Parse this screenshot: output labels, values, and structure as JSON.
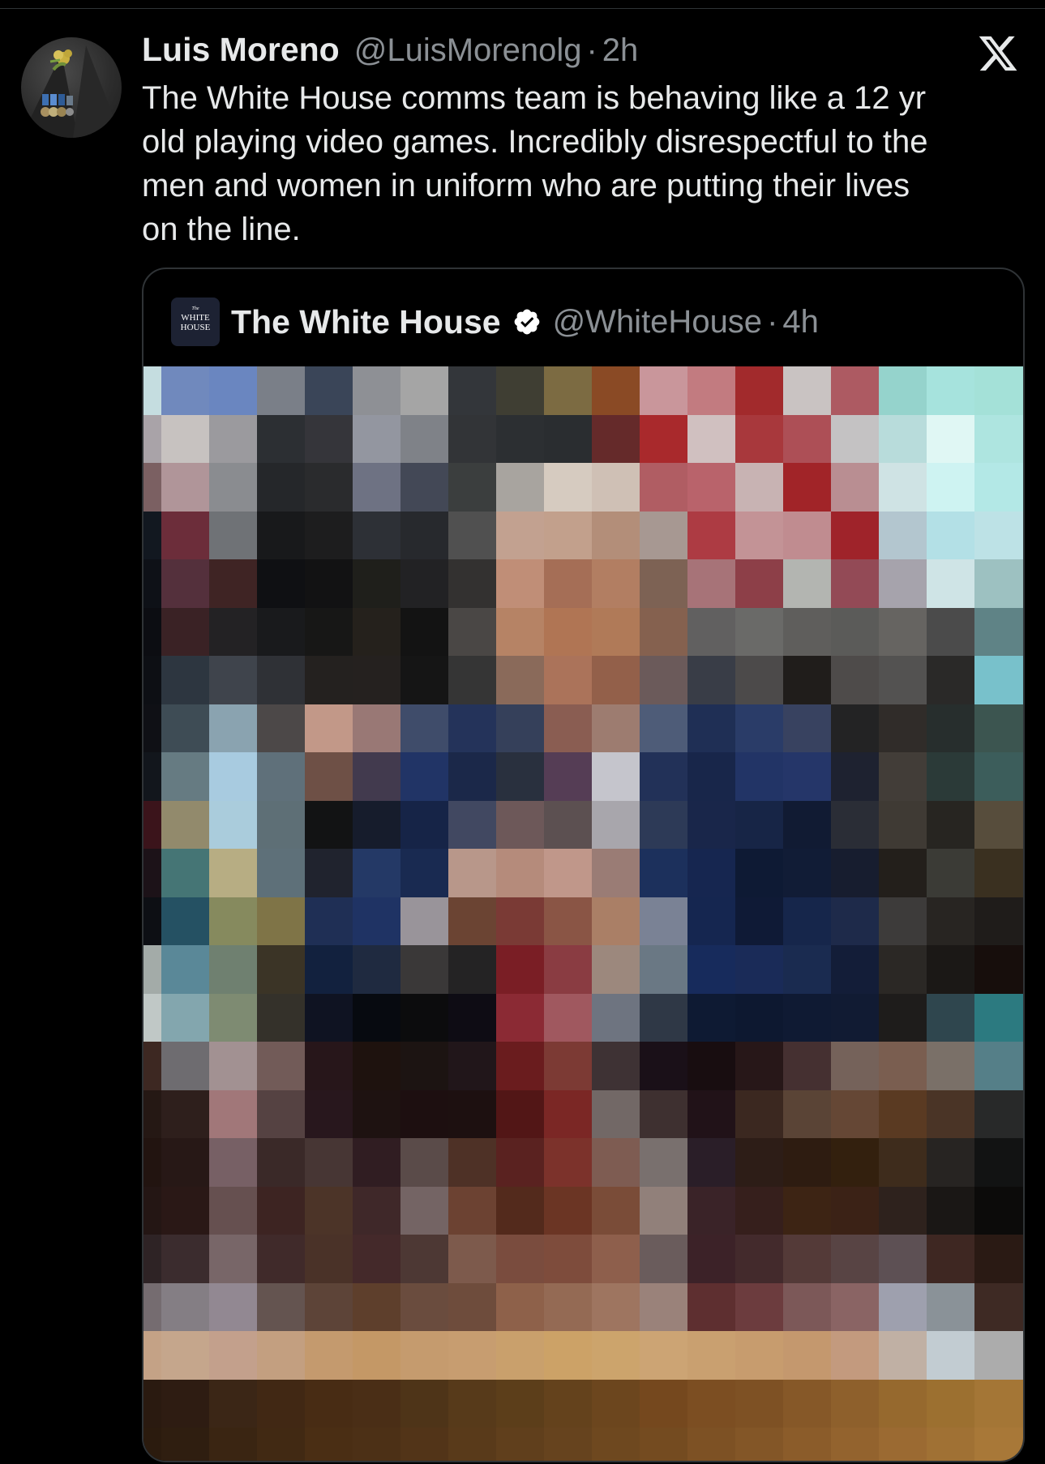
{
  "post": {
    "author_name": "Luis Moreno",
    "author_handle": "@LuisMorenolg",
    "separator": "·",
    "time": "2h",
    "text_lines": [
      "The White House comms team is behaving like a 12 yr",
      "old playing video games. Incredibly disrespectful to the",
      "men and women in uniform who are putting their lives",
      "on the line."
    ],
    "avatar_icon": "uniform-lapel-pin-medals",
    "brand_icon": "x-logo-icon"
  },
  "quote": {
    "author_name": "The White House",
    "author_handle": "@WhiteHouse",
    "separator": "·",
    "time": "4h",
    "avatar_text": {
      "the": "The",
      "white": "WHITE",
      "house": "HOUSE"
    },
    "verified_icon": "verified-badge-icon",
    "media_description": "pixelated image"
  },
  "colors": {
    "background": "#000000",
    "primary_text": "#e7e9ea",
    "secondary_text": "#8b9095",
    "border": "#2f3336",
    "verified_badge": "#ffffff"
  }
}
